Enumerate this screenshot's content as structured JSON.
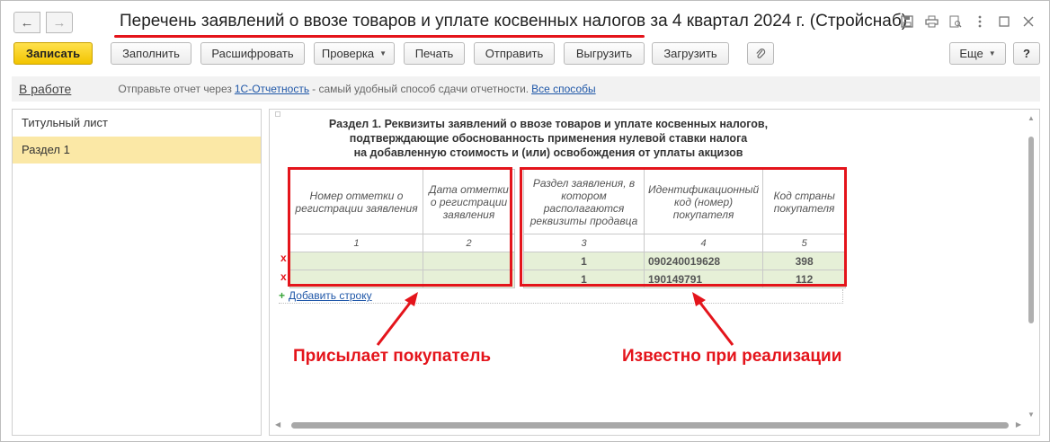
{
  "window": {
    "title": "Перечень заявлений о ввозе товаров и уплате косвенных налогов за 4 квартал 2024 г. (Стройснаб)"
  },
  "nav": {
    "back": "←",
    "forward": "→"
  },
  "toolbar": {
    "save": "Записать",
    "fill": "Заполнить",
    "decode": "Расшифровать",
    "check": "Проверка",
    "print": "Печать",
    "send": "Отправить",
    "export": "Выгрузить",
    "import": "Загрузить",
    "more": "Еще",
    "help": "?"
  },
  "infobar": {
    "status": "В работе",
    "text_before": "Отправьте отчет через",
    "link1": "1С-Отчетность",
    "text_middle": "- самый удобный способ сдачи отчетности.",
    "link2": "Все способы"
  },
  "sidebar": {
    "items": [
      {
        "label": "Титульный лист"
      },
      {
        "label": "Раздел 1"
      }
    ]
  },
  "section": {
    "title_lines": [
      "Раздел 1. Реквизиты заявлений о ввозе товаров и уплате косвенных налогов,",
      "подтверждающие обоснованность применения нулевой ставки налога",
      "на добавленную стоимость и (или) освобождения от уплаты акцизов"
    ]
  },
  "table": {
    "headers": [
      "Номер отметки о регистрации заявления",
      "Дата отметки о регистрации заявления",
      "Раздел заявления, в котором располагаются реквизиты продавца",
      "Идентификационный код (номер) покупателя",
      "Код страны покупателя"
    ],
    "numbers": [
      "1",
      "2",
      "3",
      "4",
      "5"
    ],
    "rows": [
      {
        "mark": "x",
        "c1": "",
        "c2": "",
        "c3": "1",
        "c4": "090240019628",
        "c5": "398"
      },
      {
        "mark": "x",
        "c1": "",
        "c2": "",
        "c3": "1",
        "c4": "190149791",
        "c5": "112"
      }
    ],
    "add_row": "Добавить строку"
  },
  "annotations": {
    "left": "Присылает покупатель",
    "right": "Известно при реализации"
  },
  "colors": {
    "accent_red": "#e4141b",
    "primary_button": "#f2c400",
    "row_fill": "#e6f0d7",
    "selected_item": "#fbe8a6",
    "link": "#1f57a8"
  }
}
